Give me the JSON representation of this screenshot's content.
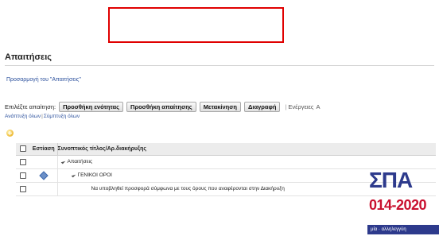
{
  "page": {
    "title": "Απαιτήσεις",
    "customize_link": "Προσαρμογή του \"Απαιτήσεις\""
  },
  "toolbar": {
    "select_label": "Επιλέξτε απαίτηση:",
    "buttons": [
      "Προσθήκη ενότητας",
      "Προσθήκη απαίτησης",
      "Μετακίνηση",
      "Διαγραφή"
    ],
    "separator": "|",
    "actions_label": "Ενέργειες",
    "truncated_label": "Α"
  },
  "tree_controls": {
    "expand_all": "Ανάπτυξη όλων",
    "separator": "|",
    "collapse_all": "Σύμπτυξη όλων"
  },
  "table": {
    "headers": {
      "focus": "Εστίαση",
      "title": "Συνοπτικός τίτλος/Αρ.διακήρυξης"
    },
    "rows": [
      {
        "text": "Απαιτήσεις",
        "level": 1,
        "has_toggle": true,
        "has_focus_icon": false
      },
      {
        "text": "ΓΕΝΙΚΟΙ ΟΡΟΙ",
        "level": 2,
        "has_toggle": true,
        "has_focus_icon": true
      },
      {
        "text": "Να υποβληθεί προσφορά σύμφωνα με τους όρους που αναφέρονται στην Διακήρυξη",
        "level": 3,
        "has_toggle": false,
        "has_focus_icon": false
      }
    ]
  },
  "logo": {
    "mark": "ΣΠΑ",
    "years": "014-2020",
    "tagline": "μία · αλληλεγγύη"
  },
  "colors": {
    "link": "#2a4f9c",
    "highlight_box": "#e00000",
    "logo_blue": "#2d3a8c",
    "logo_red": "#c9102f"
  }
}
